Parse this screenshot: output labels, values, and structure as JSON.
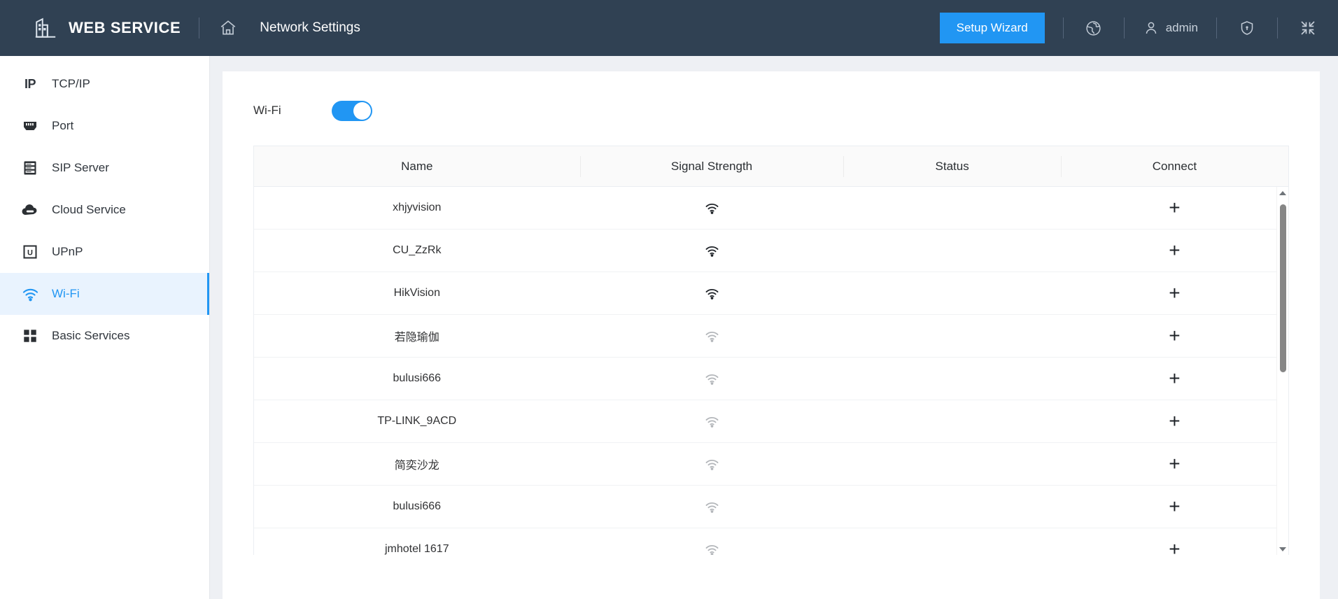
{
  "header": {
    "logo_icon": "building-icon",
    "brand": "WEB SERVICE",
    "home_icon": "home-icon",
    "page_title": "Network Settings",
    "setup_wizard_label": "Setup Wizard",
    "language_icon": "globe-icon",
    "user_icon": "person-icon",
    "user_name": "admin",
    "security_icon": "shield-icon",
    "collapse_icon": "collapse-icon",
    "background_color": "#304153",
    "accent_color": "#2196f3"
  },
  "sidebar": {
    "items": [
      {
        "label": "TCP/IP",
        "icon": "ip-icon",
        "active": false
      },
      {
        "label": "Port",
        "icon": "ethernet-port-icon",
        "active": false
      },
      {
        "label": "SIP Server",
        "icon": "server-icon",
        "active": false
      },
      {
        "label": "Cloud Service",
        "icon": "cloud-icon",
        "active": false
      },
      {
        "label": "UPnP",
        "icon": "upnp-icon",
        "active": false
      },
      {
        "label": "Wi-Fi",
        "icon": "wifi-icon",
        "active": true
      },
      {
        "label": "Basic Services",
        "icon": "grid-icon",
        "active": false
      }
    ],
    "active_color": "#2196f3",
    "active_background": "#e9f3fe"
  },
  "main": {
    "wifi_toggle": {
      "label": "Wi-Fi",
      "state": "on",
      "on_color": "#2196f3"
    },
    "table": {
      "columns": [
        "Name",
        "Signal Strength",
        "Status",
        "Connect"
      ],
      "connect_icon": "plus-icon",
      "signal_icon": "wifi-signal-icon",
      "rows": [
        {
          "name": "xhjyvision",
          "signal": "strong",
          "status": "",
          "connect": "+"
        },
        {
          "name": "CU_ZzRk",
          "signal": "strong",
          "status": "",
          "connect": "+"
        },
        {
          "name": "HikVision",
          "signal": "strong",
          "status": "",
          "connect": "+"
        },
        {
          "name": "若隐瑜伽",
          "signal": "weak",
          "status": "",
          "connect": "+"
        },
        {
          "name": "bulusi666",
          "signal": "weak",
          "status": "",
          "connect": "+"
        },
        {
          "name": "TP-LINK_9ACD",
          "signal": "weak",
          "status": "",
          "connect": "+"
        },
        {
          "name": "简奕沙龙",
          "signal": "weak",
          "status": "",
          "connect": "+"
        },
        {
          "name": "bulusi666",
          "signal": "weak",
          "status": "",
          "connect": "+"
        },
        {
          "name": "jmhotel 1617",
          "signal": "weak",
          "status": "",
          "connect": "+"
        }
      ]
    },
    "scrollbar": {
      "up_arrow_icon": "triangle-up-icon",
      "down_arrow_icon": "triangle-down-icon",
      "position": "top"
    }
  }
}
